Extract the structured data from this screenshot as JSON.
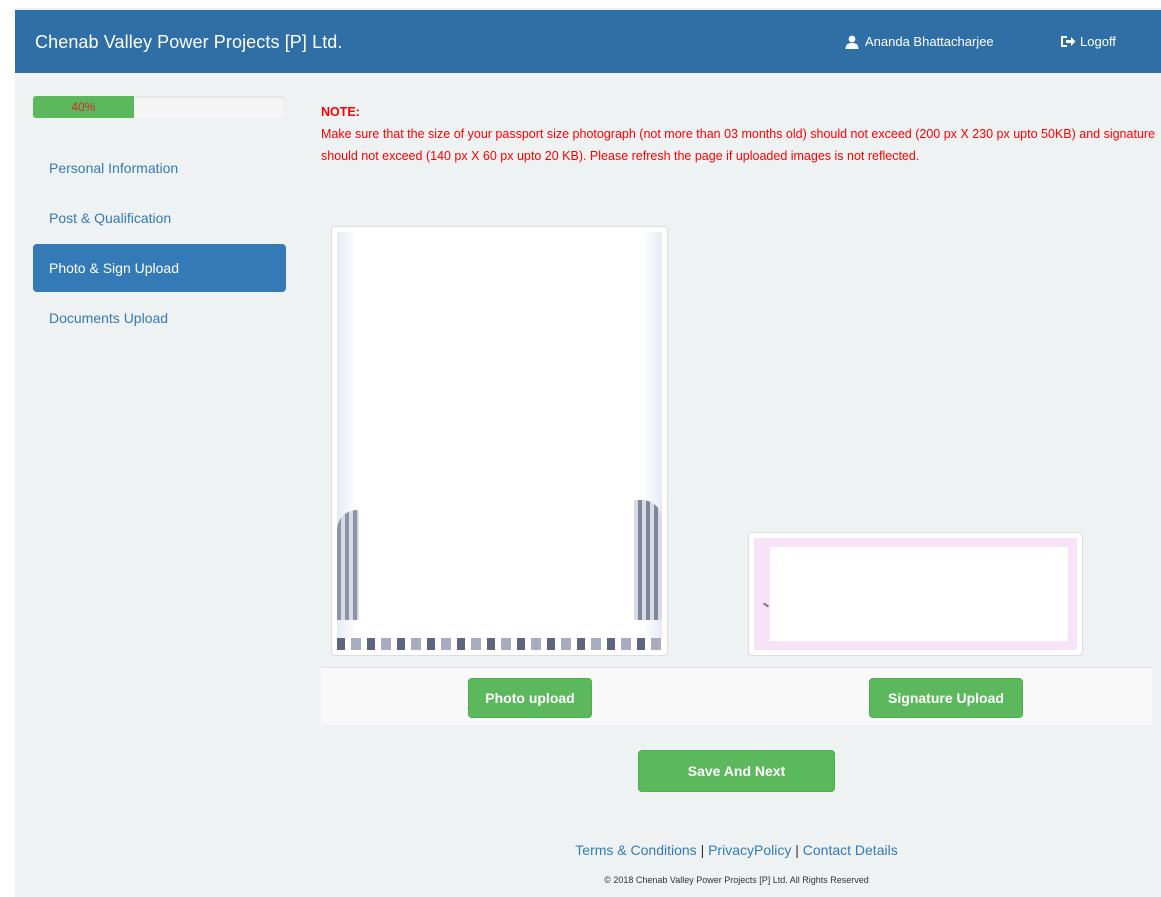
{
  "header": {
    "brand": "Chenab Valley Power Projects [P] Ltd.",
    "user_name": "Ananda Bhattacharjee",
    "logoff_label": "Logoff",
    "bg_color": "#2f6fa6"
  },
  "progress": {
    "label": "40%",
    "value": 0.4,
    "color": "#5cb85c"
  },
  "sidebar": {
    "items": [
      {
        "label": "Personal Information",
        "active": false
      },
      {
        "label": "Post & Qualification",
        "active": false
      },
      {
        "label": "Photo & Sign Upload",
        "active": true
      },
      {
        "label": "Documents Upload",
        "active": false
      }
    ]
  },
  "note": {
    "title": "NOTE:",
    "body": "Make sure that the size of your passport size photograph (not more than 03 months old) should not exceed (200 px X 230 px upto 50KB) and signature should not exceed (140 px X 60 px upto 20 KB). Please refresh the page if uploaded images is not reflected.",
    "color": "#ff0000"
  },
  "uploads": {
    "photo_button": "Photo upload",
    "signature_button": "Signature Upload"
  },
  "actions": {
    "save_next": "Save And Next"
  },
  "footer": {
    "terms": "Terms & Conditions",
    "privacy": "PrivacyPolicy",
    "contact": "Contact Details",
    "separator": "|",
    "copyright": "© 2018 Chenab Valley Power Projects [P] Ltd.  All Rights Reserved"
  }
}
